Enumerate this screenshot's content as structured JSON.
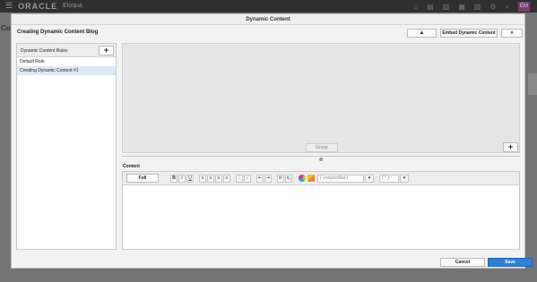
{
  "app": {
    "brand": "ORACLE",
    "product": "Eloqua",
    "avatar": "EM",
    "edge_title": "Co"
  },
  "modal": {
    "title": "Dynamic Content",
    "page_title": "Creating Dynamic Content Blog",
    "up_label": "▲",
    "embed_label": "Embed Dynamic Content",
    "forward_label": "»"
  },
  "rules": {
    "header": "Dynamic Content Rules",
    "add_label": "+",
    "items": [
      {
        "label": "Default Rule"
      },
      {
        "label": "Creating Dynamic Content #1"
      }
    ]
  },
  "group": {
    "label": "Group",
    "add_label": "+"
  },
  "content": {
    "label": "Content",
    "mode_label": "Full",
    "font_family_value": "( unspecified )",
    "font_size_value": "( * )",
    "toolbar_icons": [
      "bold-icon",
      "italic-icon",
      "underline-icon",
      "align-left-icon",
      "align-center-icon",
      "align-right-icon",
      "align-justify-icon",
      "ordered-list-icon",
      "unordered-list-icon",
      "outdent-icon",
      "indent-icon",
      "superscript-icon",
      "subscript-icon",
      "color-picker-icon",
      "highlight-icon"
    ]
  },
  "footer": {
    "cancel_label": "Cancel",
    "save_label": "Save"
  },
  "colors": {
    "accent": "#2f7fd6",
    "selected_row": "#dce9f6"
  }
}
